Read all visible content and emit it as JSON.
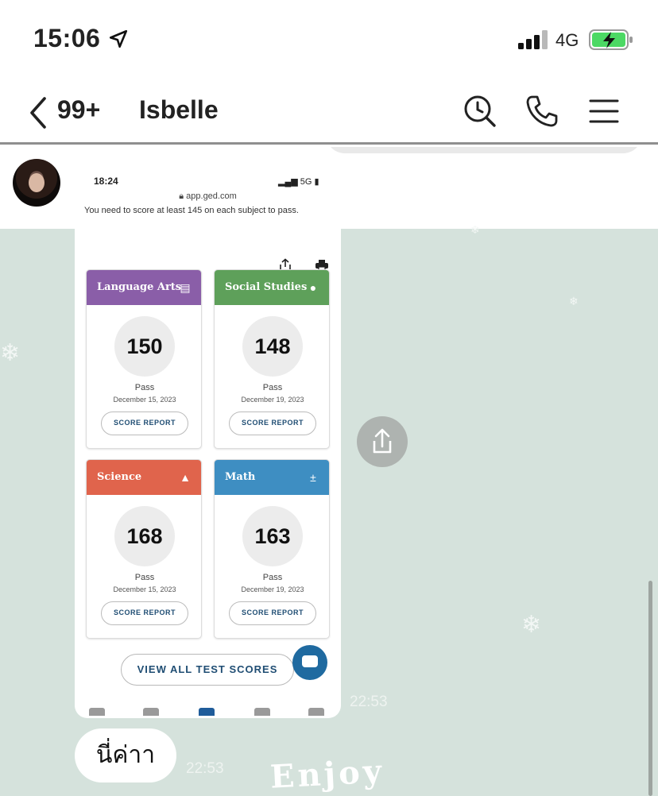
{
  "status_bar": {
    "time": "15:06",
    "network": "4G"
  },
  "header": {
    "back_count": "99+",
    "chat_name": "Isbelle"
  },
  "image_message": {
    "status_time": "18:24",
    "status_signal": "5G",
    "url": "app.ged.com",
    "note": "You need to score at least 145 on each subject to pass.",
    "cards": [
      {
        "subject": "Language Arts",
        "score": "150",
        "status": "Pass",
        "date": "December 15, 2023",
        "button": "SCORE REPORT",
        "color": "#8a5ea8"
      },
      {
        "subject": "Social Studies",
        "score": "148",
        "status": "Pass",
        "date": "December 19, 2023",
        "button": "SCORE REPORT",
        "color": "#5ea05a"
      },
      {
        "subject": "Science",
        "score": "168",
        "status": "Pass",
        "date": "December 15, 2023",
        "button": "SCORE REPORT",
        "color": "#e0644c"
      },
      {
        "subject": "Math",
        "score": "163",
        "status": "Pass",
        "date": "December 19, 2023",
        "button": "SCORE REPORT",
        "color": "#3e8ec2"
      }
    ],
    "view_all": "VIEW ALL TEST SCORES",
    "time": "22:53"
  },
  "text_message": {
    "text": "นี่ค่าา",
    "time": "22:53"
  },
  "sticker_text": "Enjoy",
  "colors": {
    "chat_bg": "#d5e2dc"
  }
}
